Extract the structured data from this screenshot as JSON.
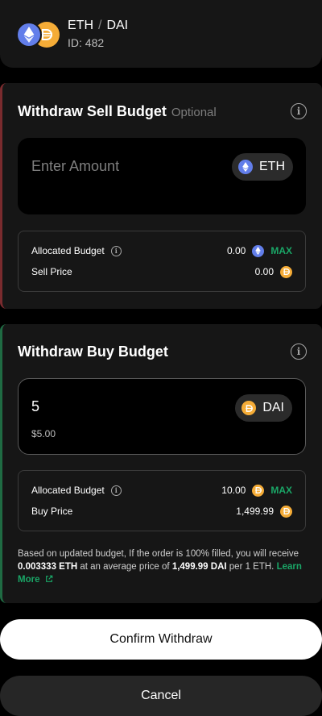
{
  "header": {
    "base_token": "ETH",
    "separator": "/",
    "quote_token": "DAI",
    "id_label": "ID: 482"
  },
  "sell": {
    "title": "Withdraw Sell Budget",
    "optional": "Optional",
    "amount_placeholder": "Enter Amount",
    "token": "ETH",
    "allocated_label": "Allocated Budget",
    "allocated_value": "0.00",
    "max_label": "MAX",
    "price_label": "Sell Price",
    "price_value": "0.00"
  },
  "buy": {
    "title": "Withdraw Buy Budget",
    "amount_value": "5",
    "amount_usd": "$5.00",
    "token": "DAI",
    "allocated_label": "Allocated Budget",
    "allocated_value": "10.00",
    "max_label": "MAX",
    "price_label": "Buy Price",
    "price_value": "1,499.99"
  },
  "note": {
    "part1": "Based on updated budget, If the order is 100% filled, you will receive ",
    "receive_amount": "0.003333 ETH",
    "part2": " at an average price of ",
    "avg_price": "1,499.99 DAI",
    "part3": " per 1 ETH. ",
    "learn_more": "Learn More"
  },
  "buttons": {
    "confirm": "Confirm Withdraw",
    "cancel": "Cancel"
  },
  "colors": {
    "eth": "#627eea",
    "dai": "#f5ac37",
    "accent_green": "#1aa667",
    "sell_border": "#7a2b2e",
    "buy_border": "#1f6b43"
  },
  "icons": [
    "eth-icon",
    "dai-icon",
    "info-icon",
    "external-link-icon"
  ]
}
